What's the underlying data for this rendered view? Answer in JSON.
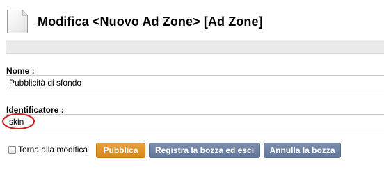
{
  "header": {
    "title": "Modifica <Nuovo Ad Zone> [Ad Zone]",
    "icon": "document-icon"
  },
  "fields": {
    "name": {
      "label": "Nome :",
      "value": "Pubblicità di sfondo"
    },
    "identifier": {
      "label": "Identificatore :",
      "value": "skin"
    }
  },
  "actions": {
    "back_to_edit_label": "Torna alla modifica",
    "back_to_edit_checked": false,
    "publish_label": "Pubblica",
    "save_draft_label": "Registra la bozza ed esci",
    "cancel_draft_label": "Annulla la bozza"
  },
  "colors": {
    "publish_button": "#e0952c",
    "secondary_button": "#6f83a5",
    "highlight": "#cc1f1f"
  }
}
